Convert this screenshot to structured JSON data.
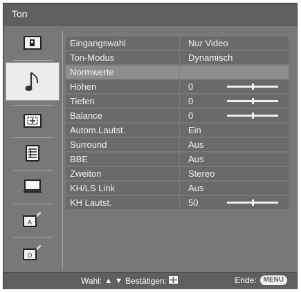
{
  "title": "Ton",
  "sidebar": {
    "items": [
      {
        "icon": "picture-icon"
      },
      {
        "icon": "music-note-icon",
        "active": true
      },
      {
        "icon": "screen-format-icon"
      },
      {
        "icon": "features-list-icon"
      },
      {
        "icon": "pc-monitor-icon"
      },
      {
        "icon": "analog-channel-icon"
      },
      {
        "icon": "digital-channel-icon"
      }
    ]
  },
  "menu": [
    {
      "label": "Eingangswahl",
      "value": "Nur Video"
    },
    {
      "label": "Ton-Modus",
      "value": "Dynamisch"
    },
    {
      "label": "Normwerte",
      "value": "",
      "highlighted": true
    },
    {
      "label": "Höhen",
      "value": "0",
      "level": 0.5
    },
    {
      "label": "Tiefen",
      "value": "0",
      "level": 0.5
    },
    {
      "label": "Balance",
      "value": "0",
      "level": 0.5
    },
    {
      "label": "Autom.Lautst.",
      "value": "Ein"
    },
    {
      "label": "Surround",
      "value": "Aus"
    },
    {
      "label": "BBE",
      "value": "Aus"
    },
    {
      "label": "Zweiton",
      "value": "Stereo"
    },
    {
      "label": "KH/LS Link",
      "value": "Aus"
    },
    {
      "label": "KH Lautst.",
      "value": "50",
      "level": 0.5
    }
  ],
  "footer": {
    "select_label": "Wahl:",
    "up_arrow": "▲",
    "down_arrow": "▼",
    "confirm_label": "Bestätigen:",
    "exit_label": "Ende:",
    "menu_button": "MENU"
  },
  "colors": {
    "frame": "#787878",
    "bar": "#5f5f5f",
    "row": "#6a6a6a",
    "row_highlight": "#8e8e8e",
    "text": "#f2f2f2"
  }
}
